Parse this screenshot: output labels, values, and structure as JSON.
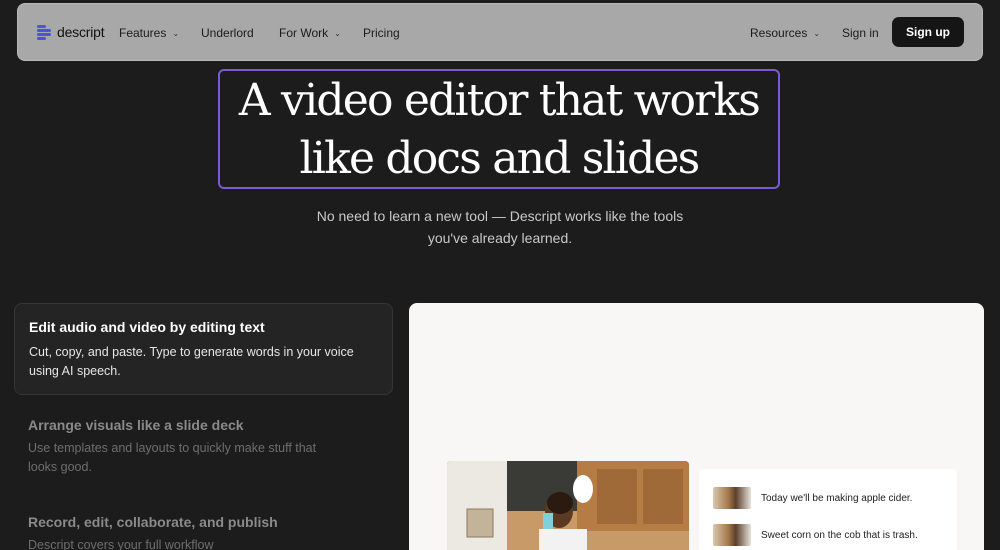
{
  "nav": {
    "logo": "descript",
    "links": [
      {
        "label": "Features",
        "chevron": true
      },
      {
        "label": "Underlord",
        "chevron": false
      },
      {
        "label": "For Work",
        "chevron": true
      },
      {
        "label": "Pricing",
        "chevron": false
      }
    ],
    "resources": "Resources",
    "signin": "Sign in",
    "signup": "Sign up"
  },
  "hero": {
    "headline_line1": "A video editor that works",
    "headline_line2": "like docs and slides",
    "sub_line1": "No need to learn a new tool — Descript works like the tools",
    "sub_line2": "you've already learned."
  },
  "features": [
    {
      "title": "Edit audio and video by editing text",
      "desc": "Cut, copy, and paste. Type to generate words in your voice using AI speech."
    },
    {
      "title": "Arrange visuals like a slide deck",
      "desc": "Use templates and layouts to quickly make stuff that looks good."
    },
    {
      "title": "Record, edit, collaborate, and publish",
      "desc": "Descript covers your full workflow"
    }
  ],
  "preview": {
    "transcript": [
      "Today we'll be making apple cider.",
      "Sweet corn on the cob that is trash."
    ]
  }
}
